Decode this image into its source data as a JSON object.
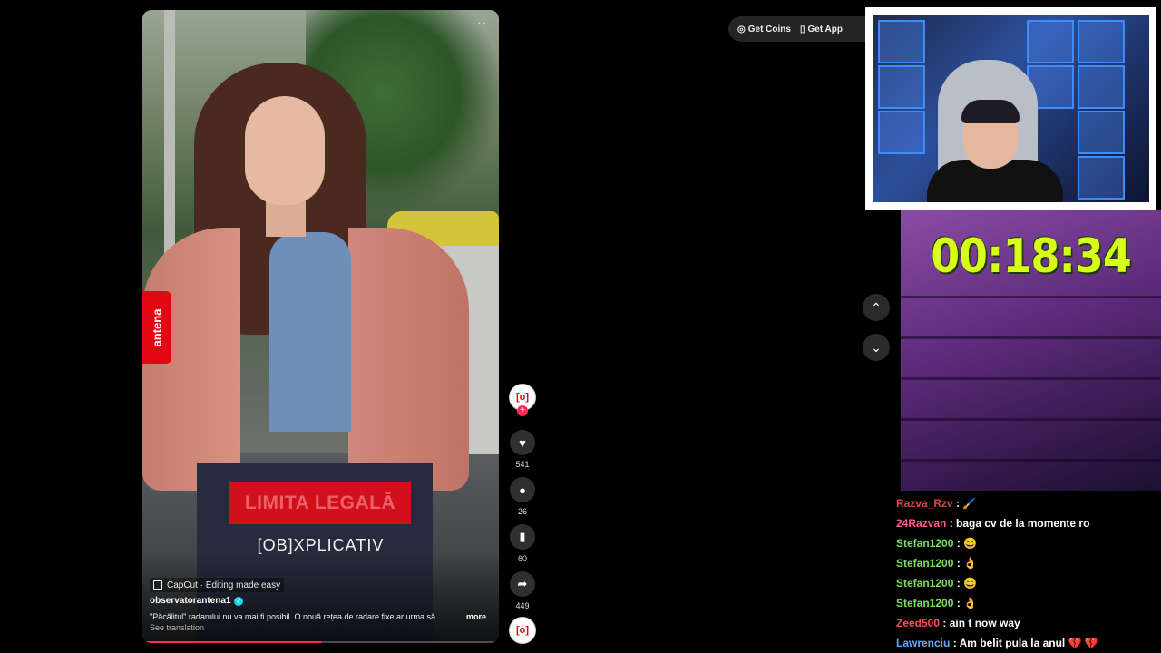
{
  "video": {
    "dots": "···",
    "antena_logo": "antena",
    "overlay_title": "LIMITA LEGALĂ",
    "overlay_brand": "[OB]XPLICATIV",
    "capcut": "CapCut · Editing made easy",
    "author": "observatorantena1",
    "caption": "\"Păcălitul\" radarului nu va mai fi posibil. O nouă rețea de radare fixe ar urma să ...",
    "more": "more",
    "see_translation": "See translation",
    "progress": 0.5
  },
  "actions": {
    "avatar_text": "[o]",
    "follow": "+",
    "likes": "541",
    "comments": "26",
    "saves": "60",
    "shares": "449"
  },
  "header": {
    "get_coins": "Get Coins",
    "get_app": "Get App"
  },
  "nav": {
    "up": "⌃",
    "down": "⌄"
  },
  "stream": {
    "timer": "00:18:34"
  },
  "chat": [
    {
      "user": "Razva_Rzv",
      "color": "#e0414b",
      "text": " : 🖌️"
    },
    {
      "user": "24Razvan",
      "color": "#ff5a8a",
      "text": " : baga cv de la momente ro"
    },
    {
      "user": "Stefan1200",
      "color": "#7be05c",
      "text": " : 😄"
    },
    {
      "user": "Stefan1200",
      "color": "#7be05c",
      "text": " : 👌"
    },
    {
      "user": "Stefan1200",
      "color": "#7be05c",
      "text": " : 😄"
    },
    {
      "user": "Stefan1200",
      "color": "#7be05c",
      "text": " : 👌"
    },
    {
      "user": "Zeed500",
      "color": "#ff4d4d",
      "text": " : ain t now way"
    },
    {
      "user": "Lawrenciu",
      "color": "#5aa9ff",
      "text": " : Am belit pula la anul 💔 💔"
    }
  ]
}
